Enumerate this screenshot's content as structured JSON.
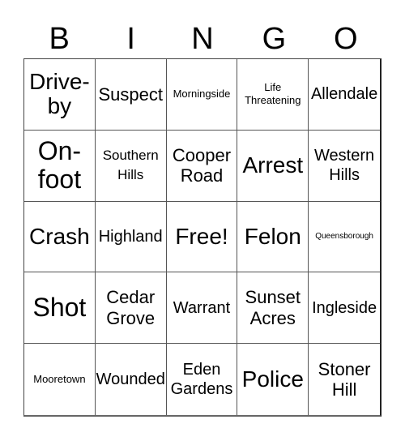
{
  "title_letters": [
    "B",
    "I",
    "N",
    "G",
    "O"
  ],
  "board": {
    "rows": [
      [
        "Drive-by",
        "Suspect",
        "Morningside",
        "Life Threatening",
        "Allendale"
      ],
      [
        "On-foot",
        "Southern Hills",
        "Cooper Road",
        "Arrest",
        "Western Hills"
      ],
      [
        "Crash",
        "Highland",
        "Free!",
        "Felon",
        "Queensborough"
      ],
      [
        "Shot",
        "Cedar Grove",
        "Warrant",
        "Sunset Acres",
        "Ingleside"
      ],
      [
        "Mooretown",
        "Wounded",
        "Eden Gardens",
        "Police",
        "Stoner Hill"
      ]
    ],
    "free_space": "Free!"
  }
}
